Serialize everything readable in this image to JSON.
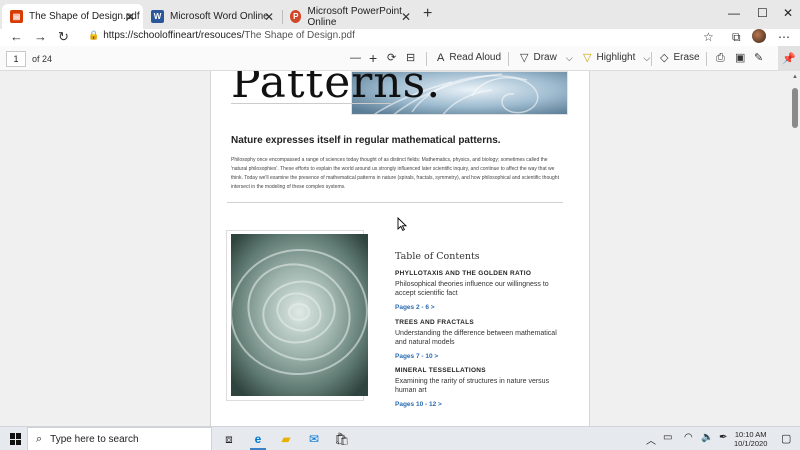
{
  "tabs": [
    {
      "label": "The Shape of Design.pdf",
      "icon": "pdf-icon",
      "active": true
    },
    {
      "label": "Microsoft Word Online",
      "icon": "word-icon",
      "active": false
    },
    {
      "label": "Microsoft PowerPoint Online",
      "icon": "powerpoint-icon",
      "active": false
    }
  ],
  "window": {
    "minimize": "—",
    "maximize": "☐",
    "close": "✕",
    "new_tab": "+",
    "tab_close": "✕"
  },
  "address": {
    "prefix": "https://schooloffineart/resouces/",
    "path": "The Shape of Design.pdf"
  },
  "pdf_toolbar": {
    "page_value": "1",
    "page_count": "of 24",
    "read_aloud": "Read Aloud",
    "draw": "Draw",
    "highlight": "Highlight",
    "erase": "Erase"
  },
  "document": {
    "title": "Patterns.",
    "subheading": "Nature expresses itself in regular mathematical patterns.",
    "body": "Philosophy once encompassed a range of sciences today thought of as distinct fields: Mathematics, physics, and biology; sometimes called the 'natural philosophies'. These efforts to explain the world around us strongly influenced later scientific inquiry, and continue to affect the way that we think. Today we'll examine the presence of mathematical patterns in nature (spirals, fractals, symmetry), and how philosophical and scientific thought intersect in the modeling of these complex systems.",
    "toc_title": "Table of Contents",
    "toc": [
      {
        "heading": "PHYLLOTAXIS AND THE GOLDEN RATIO",
        "desc": "Philosophical theories influence our willingness to accept scientific fact",
        "link": "Pages 2 - 6  >"
      },
      {
        "heading": "TREES AND FRACTALS",
        "desc": "Understanding the difference between mathematical and natural models",
        "link": "Pages 7 - 10  >"
      },
      {
        "heading": "MINERAL TESSELLATIONS",
        "desc": "Examining the rarity of structures in nature versus human art",
        "link": "Pages 10 - 12  >"
      }
    ]
  },
  "taskbar": {
    "search_placeholder": "Type here to search",
    "time": "10:10 AM",
    "date": "10/1/2020"
  },
  "colors": {
    "pdf_icon": "#d83b01",
    "word_icon": "#2b579a",
    "powerpoint_icon": "#d24726",
    "link": "#2b6cb0",
    "edge_blue": "#0078d4"
  }
}
